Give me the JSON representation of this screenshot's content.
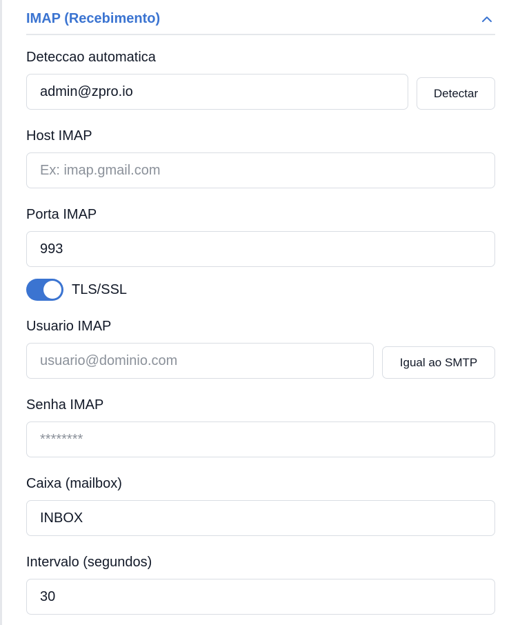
{
  "section": {
    "title": "IMAP (Recebimento)",
    "collapse_icon": "chevron-up-icon",
    "accent_color": "#3b74d1"
  },
  "autodetect": {
    "label": "Deteccao automatica",
    "value": "admin@zpro.io",
    "button_label": "Detectar"
  },
  "host": {
    "label": "Host IMAP",
    "value": "",
    "placeholder": "Ex: imap.gmail.com"
  },
  "port": {
    "label": "Porta IMAP",
    "value": "993"
  },
  "tls": {
    "label": "TLS/SSL",
    "enabled": true
  },
  "user": {
    "label": "Usuario IMAP",
    "value": "",
    "placeholder": "usuario@dominio.com",
    "button_label": "Igual ao SMTP"
  },
  "password": {
    "label": "Senha IMAP",
    "value": "",
    "placeholder": "********"
  },
  "mailbox": {
    "label": "Caixa (mailbox)",
    "value": "INBOX"
  },
  "interval": {
    "label": "Intervalo (segundos)",
    "value": "30"
  }
}
